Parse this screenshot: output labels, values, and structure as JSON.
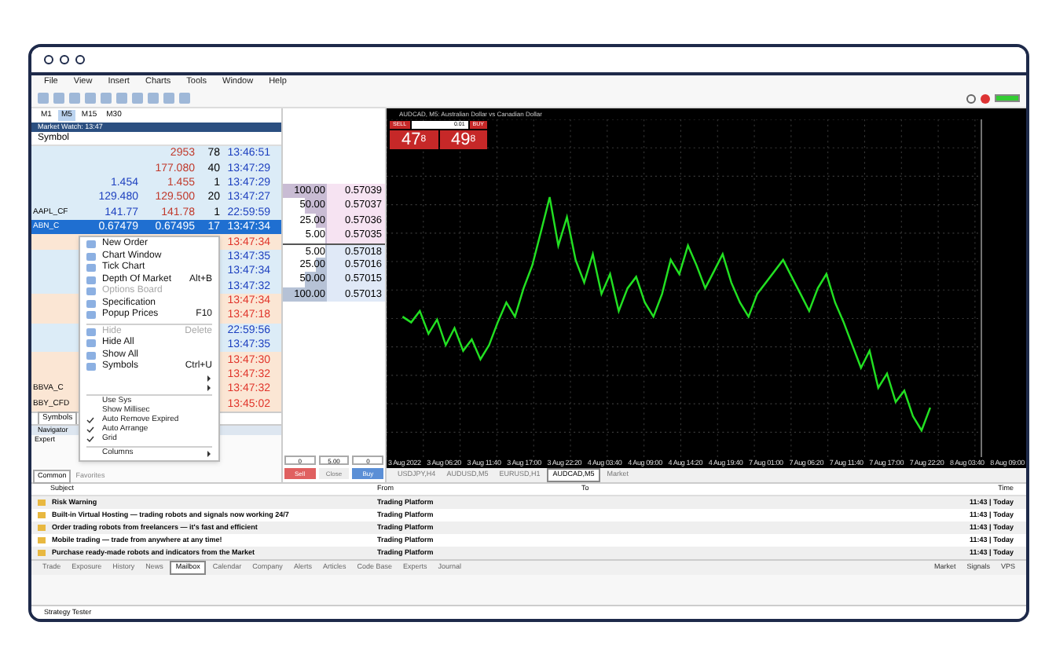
{
  "menu": [
    "File",
    "View",
    "Insert",
    "Charts",
    "Tools",
    "Window",
    "Help"
  ],
  "periods": [
    {
      "label": "M1",
      "selected": false
    },
    {
      "label": "M5",
      "selected": true
    },
    {
      "label": "M15",
      "selected": false
    },
    {
      "label": "M30",
      "selected": false
    }
  ],
  "market_watch": {
    "title": "Market Watch: 13:47",
    "columns": [
      "Symbol"
    ],
    "tabs": [
      {
        "label": "Symbols",
        "selected": true
      }
    ],
    "rows": [
      {
        "ask": "2953",
        "spread": "78",
        "time": "13:46:51",
        "down": false,
        "selected": false
      },
      {
        "ask": "177.080",
        "spread": "40",
        "time": "13:47:29",
        "down": false,
        "selected": false
      },
      {
        "bid": "1.454",
        "ask": "1.455",
        "spread": "1",
        "time": "13:47:29",
        "down": false,
        "selected": false
      },
      {
        "bid": "129.480",
        "ask": "129.500",
        "spread": "20",
        "time": "13:47:27",
        "down": false,
        "selected": false
      },
      {
        "symbol": "AAPL_CF",
        "bid": "141.77",
        "ask": "141.78",
        "spread": "1",
        "time": "22:59:59",
        "down": false,
        "selected": false
      },
      {
        "symbol": "ABN_C",
        "bid": "0.67479",
        "ask": "0.67495",
        "spread": "17",
        "time": "13:47:34",
        "down": false,
        "selected": true
      },
      {
        "time": "13:47:34",
        "down": true,
        "selected": false
      },
      {
        "time": "13:47:35",
        "down": false,
        "selected": false
      },
      {
        "time": "13:47:34",
        "down": false,
        "selected": false
      },
      {
        "time": "13:47:32",
        "down": false,
        "selected": false
      },
      {
        "time": "13:47:34",
        "down": true,
        "selected": false
      },
      {
        "time": "13:47:18",
        "down": true,
        "selected": false
      },
      {
        "time": "22:59:56",
        "down": false,
        "selected": false
      },
      {
        "time": "13:47:35",
        "down": false,
        "selected": false
      },
      {
        "time": "13:47:30",
        "down": true,
        "selected": false
      },
      {
        "time": "13:47:32",
        "down": true,
        "selected": false
      },
      {
        "symbol": "BBVA_C",
        "time": "13:47:32",
        "down": true,
        "selected": false
      },
      {
        "symbol": "BBY_CFD",
        "time": "13:45:02",
        "down": true,
        "selected": false
      }
    ]
  },
  "context_menu": [
    {
      "kind": "item",
      "label": "New Order",
      "disabled": false
    },
    {
      "kind": "item",
      "label": "Chart Window",
      "disabled": false
    },
    {
      "kind": "item",
      "label": "Tick Chart",
      "disabled": false
    },
    {
      "kind": "item",
      "label": "Depth Of Market",
      "shortcut": "Alt+B",
      "disabled": false
    },
    {
      "kind": "item",
      "label": "Options Board",
      "disabled": true
    },
    {
      "kind": "item",
      "label": "Specification",
      "disabled": false
    },
    {
      "kind": "item",
      "label": "Popup Prices",
      "shortcut": "F10",
      "disabled": false
    },
    {
      "kind": "separator"
    },
    {
      "kind": "item",
      "label": "Hide",
      "shortcut": "Delete",
      "disabled": true
    },
    {
      "kind": "item",
      "label": "Hide All",
      "disabled": false
    },
    {
      "kind": "item",
      "label": "Show All",
      "disabled": false
    },
    {
      "kind": "item",
      "label": "Symbols",
      "shortcut": "Ctrl+U",
      "disabled": false
    },
    {
      "kind": "submenu"
    },
    {
      "kind": "submenu"
    },
    {
      "kind": "separator"
    },
    {
      "kind": "check",
      "label": "Use Sys",
      "checked": false
    },
    {
      "kind": "check",
      "label": "Show Millisec",
      "checked": false
    },
    {
      "kind": "check",
      "label": "Auto Remove Expired",
      "checked": true
    },
    {
      "kind": "check",
      "label": "Auto Arrange",
      "checked": true
    },
    {
      "kind": "check",
      "label": "Grid",
      "checked": true
    },
    {
      "kind": "separator"
    },
    {
      "kind": "submenu",
      "label": "Columns"
    }
  ],
  "navigator": {
    "title": "Navigator",
    "items": [
      "Expert"
    ],
    "tabs": [
      {
        "label": "Common",
        "selected": true
      },
      {
        "label": "Favorites",
        "selected": false
      }
    ]
  },
  "depth_of_market": {
    "rows": [
      {
        "kind": "sell",
        "volume": "100.00",
        "price": "0.57039",
        "level": 1
      },
      {
        "kind": "sell",
        "volume": "50.00",
        "price": "0.57037",
        "level": 0.5
      },
      {
        "kind": "sell",
        "volume": "25.00",
        "price": "0.57036",
        "level": 0.25
      },
      {
        "kind": "sell",
        "volume": "5.00",
        "price": "0.57035",
        "level": 0.05
      },
      {
        "kind": "buy",
        "volume": "5.00",
        "price": "0.57018",
        "level": 0.05
      },
      {
        "kind": "buy",
        "volume": "25.00",
        "price": "0.57016",
        "level": 0.25
      },
      {
        "kind": "buy",
        "volume": "50.00",
        "price": "0.57015",
        "level": 0.5
      },
      {
        "kind": "buy",
        "volume": "100.00",
        "price": "0.57013",
        "level": 1
      }
    ],
    "fields": [
      "0",
      "5.00",
      "0"
    ],
    "buttons": [
      {
        "kind": "sell",
        "label": "Sell"
      },
      {
        "kind": "close",
        "label": "Close"
      },
      {
        "kind": "buy",
        "label": "Buy"
      }
    ]
  },
  "chart": {
    "title": "AUDCAD, M5: Australian Dollar vs Canadian Dollar",
    "sell_label": "SELL",
    "buy_label": "BUY",
    "lot": "0.01",
    "sell_price": "47",
    "sell_sup": "8",
    "buy_price": "49",
    "buy_sup": "8",
    "xlabels": [
      "3 Aug 2022",
      "3 Aug 06:20",
      "3 Aug 11:40",
      "3 Aug 17:00",
      "3 Aug 22:20",
      "4 Aug 03:40",
      "4 Aug 09:00",
      "4 Aug 14:20",
      "4 Aug 19:40",
      "7 Aug 01:00",
      "7 Aug 06:20",
      "7 Aug 11:40",
      "7 Aug 17:00",
      "7 Aug 22:20",
      "8 Aug 03:40",
      "8 Aug 09:00"
    ],
    "tabs": [
      {
        "label": "USDJPY,H4",
        "selected": false
      },
      {
        "label": "AUDUSD,M5",
        "selected": false
      },
      {
        "label": "EURUSD,H1",
        "selected": false
      },
      {
        "label": "AUDCAD,M5",
        "selected": true
      },
      {
        "label": "Market",
        "selected": false
      }
    ]
  },
  "mailbox": {
    "columns": [
      "Subject",
      "From",
      "To",
      "Time"
    ],
    "rows": [
      {
        "subject": "Risk Warning",
        "from": "Trading Platform",
        "time": "11:43 | Today"
      },
      {
        "subject": "Built-in Virtual Hosting — trading robots and signals now working 24/7",
        "from": "Trading Platform",
        "time": "11:43 | Today"
      },
      {
        "subject": "Order trading robots from freelancers — it's fast and efficient",
        "from": "Trading Platform",
        "time": "11:43 | Today"
      },
      {
        "subject": "Mobile trading — trade from anywhere at any time!",
        "from": "Trading Platform",
        "time": "11:43 | Today"
      },
      {
        "subject": "Purchase ready-made robots and indicators from the Market",
        "from": "Trading Platform",
        "time": "11:43 | Today"
      }
    ]
  },
  "toolbox_tabs": [
    {
      "label": "Trade",
      "selected": false
    },
    {
      "label": "Exposure",
      "selected": false
    },
    {
      "label": "History",
      "selected": false
    },
    {
      "label": "News",
      "selected": false
    },
    {
      "label": "Mailbox",
      "selected": true
    },
    {
      "label": "Calendar",
      "selected": false
    },
    {
      "label": "Company",
      "selected": false
    },
    {
      "label": "Alerts",
      "selected": false
    },
    {
      "label": "Articles",
      "selected": false
    },
    {
      "label": "Code Base",
      "selected": false
    },
    {
      "label": "Experts",
      "selected": false
    },
    {
      "label": "Journal",
      "selected": false
    }
  ],
  "services": [
    "Market",
    "Signals",
    "VPS"
  ],
  "strategy_tester": "Strategy Tester"
}
